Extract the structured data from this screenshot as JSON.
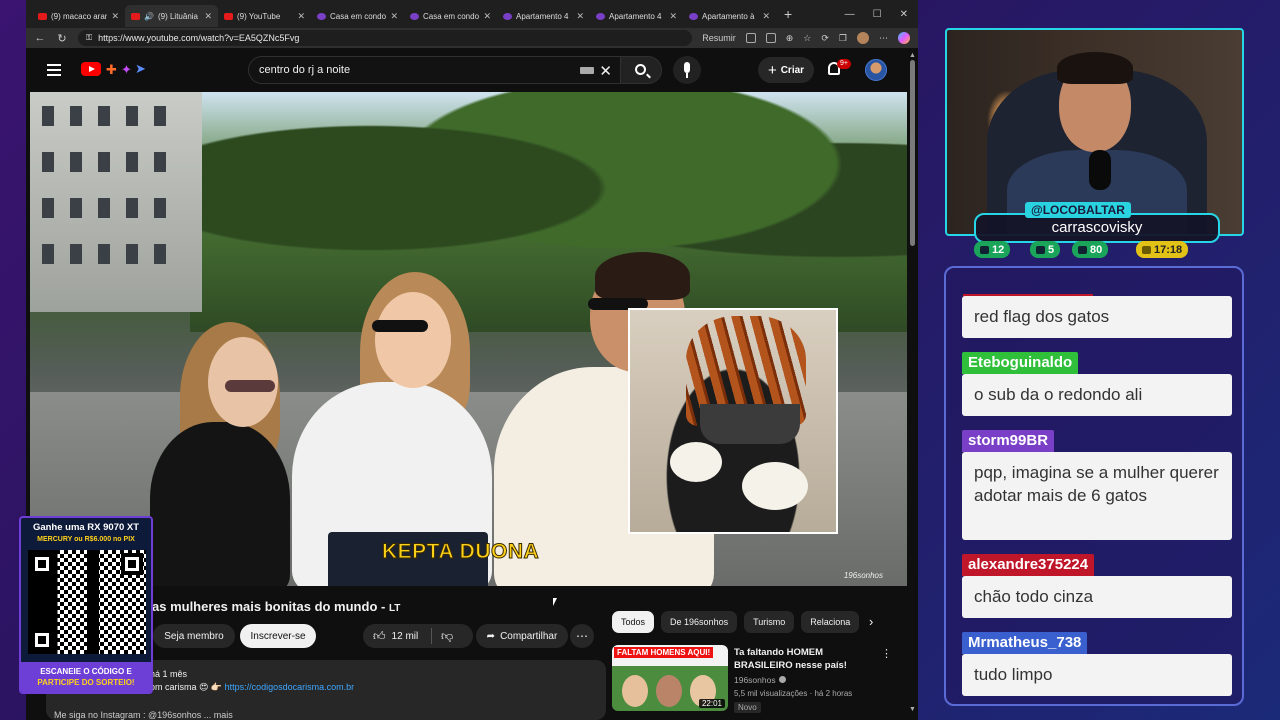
{
  "browser": {
    "tabs": [
      {
        "title": "(9) macaco aran",
        "icon": "youtube-icon"
      },
      {
        "title": "(9) Lituânia",
        "icon": "youtube-icon",
        "active": true
      },
      {
        "title": "(9) YouTube",
        "icon": "youtube-icon"
      },
      {
        "title": "Casa em condon",
        "icon": "dz-icon"
      },
      {
        "title": "Casa em condon",
        "icon": "dz-icon"
      },
      {
        "title": "Apartamento 4",
        "icon": "dz-icon"
      },
      {
        "title": "Apartamento 4",
        "icon": "dz-icon"
      },
      {
        "title": "Apartamento à",
        "icon": "dz-icon"
      }
    ],
    "url": "https://www.youtube.com/watch?v=EA5QZNc5Fvg",
    "summarize_label": "Resumir"
  },
  "youtube": {
    "search_value": "centro do rj a noite",
    "create_label": "Criar",
    "notification_count": "9+",
    "video_caption": "KEPTA DUONA",
    "video_watermark": "196sonhos",
    "video_title": "as mulheres mais bonitas do mundo - ",
    "video_title_suffix": "LT",
    "join_label": "Seja membro",
    "subscribe_label": "Inscrever-se",
    "likes": "12 mil",
    "share_label": "Compartilhar",
    "description": {
      "age": "há 1 mês",
      "line2_prefix": "om carisma 😍 👉🏻 ",
      "link": "https://codigosdocarisma.com.br",
      "line3": "Me siga no Instagram : @196sonhos ... mais"
    },
    "chips": [
      "Todos",
      "De 196sonhos",
      "Turismo",
      "Relaciona"
    ],
    "related": {
      "thumb_banner": "FALTAM HOMENS AQUI!",
      "duration": "22:01",
      "title": "Ta faltando HOMEM BRASILEIRO nesse país!",
      "channel": "196sonhos",
      "meta": "5,5 mil visualizações · há 2 horas",
      "badge": "Novo"
    }
  },
  "promo": {
    "headline": "Ganhe uma RX 9070 XT",
    "subline": "MERCURY ou R$6.000 no PIX",
    "footer_line1": "ESCANEIE O CÓDIGO E",
    "footer_line2": "PARTICIPE DO SORTEIO!"
  },
  "stream": {
    "handle": "@LOCOBALTAR",
    "name": "carrascovisky",
    "stats": [
      {
        "icon": "chat-icon",
        "value": "12"
      },
      {
        "icon": "video-icon",
        "value": "5"
      },
      {
        "icon": "viewers-icon",
        "value": "80"
      },
      {
        "icon": "clock-icon",
        "value": "17:18"
      }
    ]
  },
  "chat": [
    {
      "user": "",
      "color": "#c0162a",
      "text": "red flag dos gatos"
    },
    {
      "user": "Eteboguinaldo",
      "color": "#2fbf3a",
      "text": "o sub da o redondo ali"
    },
    {
      "user": "storm99BR",
      "color": "#7a3fc7",
      "text": "pqp, imagina se a mulher querer adotar mais de 6 gatos"
    },
    {
      "user": "alexandre375224",
      "color": "#c0162a",
      "text": "chão todo cinza"
    },
    {
      "user": "Mrmatheus_738",
      "color": "#3a5fcf",
      "text": "tudo limpo"
    }
  ]
}
